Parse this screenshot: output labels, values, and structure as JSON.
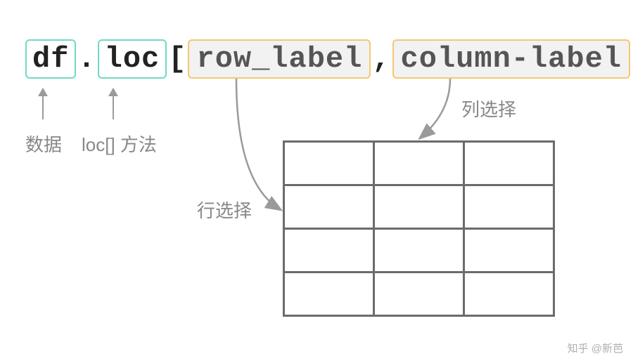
{
  "code": {
    "df": "df",
    "dot": ".",
    "loc": "loc",
    "open_bracket": "[",
    "row_label": "row_label",
    "comma": ",",
    "column_label": "column-label",
    "close_bracket": "]"
  },
  "labels": {
    "data": "数据",
    "loc_method": "loc[] 方法",
    "row_select": "行选择",
    "column_select": "列选择"
  },
  "watermark": "知乎 @新芭",
  "table": {
    "rows": 4,
    "cols": 3
  }
}
